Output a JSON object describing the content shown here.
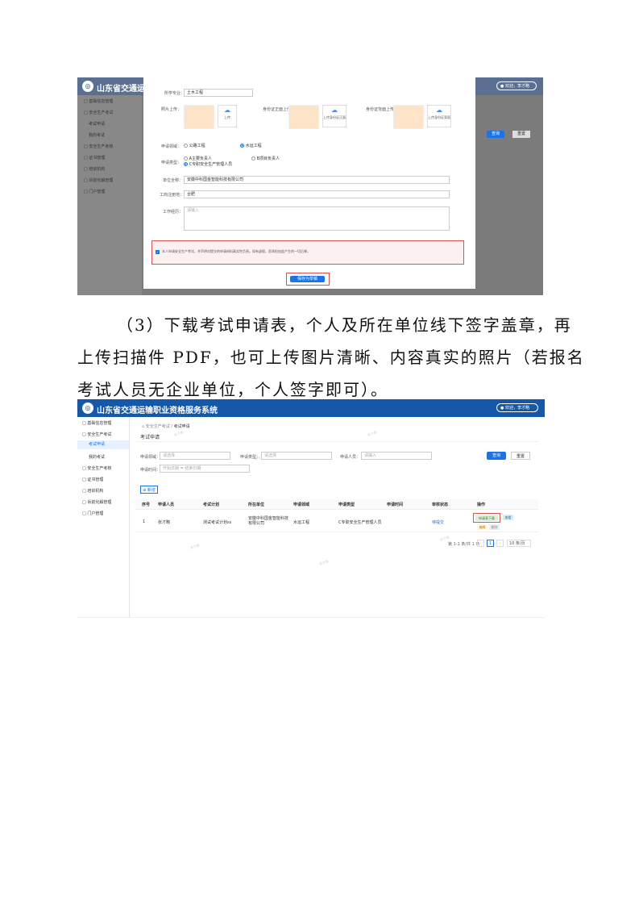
{
  "shot1": {
    "app_title": "山东省交通运输职业资格服务系统",
    "app_title_visible": "山东省交通运输职",
    "user_label": "欢迎，李才略",
    "sidebar": [
      "基础信息管理",
      "安全生产考试",
      "考试申请",
      "我的考试",
      "安全生产考核",
      "证书管理",
      "培训机构",
      "诉前化解管理",
      "门户管理"
    ],
    "form": {
      "major_label": "所学专业：",
      "major_value": "土木工程",
      "photo_label": "照片上传：",
      "id_front_label": "身份证正面上传：",
      "id_back_label": "身份证背面上传：",
      "upload_text": "上传",
      "upload_id_front": "上传身份证正面",
      "upload_id_back": "上传身份证背面",
      "field_label": "申请领域：",
      "field_options": [
        "公路工程",
        "水运工程"
      ],
      "type_label": "申请类型：",
      "type_options": [
        "A主要负责人",
        "B项目负责人",
        "C专职安全生产管理人员"
      ],
      "unit_label": "单位全称：",
      "unit_value": "安徽中科国金智能科技有限公司",
      "business_label": "工商注册地：",
      "business_value": "合肥",
      "experience_label": "工作经历：",
      "experience_placeholder": "请输入",
      "agreement_text": "本人申请安全生产考试，并声明对提交的申请材料真实性负责。如有虚假，愿承担由此产生的一切后果。",
      "submit_label": "保存为草稿",
      "query_label": "查询",
      "reset_label": "重置"
    }
  },
  "paragraph": {
    "line1": "（3）下载考试申请表，个人及所在单位线下签字盖章，再",
    "line2": "上传扫描件 PDF，也可上传图片清晰、内容真实的照片（若报名",
    "line3": "考试人员无企业单位，个人签字即可）。"
  },
  "shot2": {
    "app_title": "山东省交通运输职业资格服务系统",
    "user_label": "欢迎，李才略",
    "sidebar": [
      "基础信息管理",
      "安全生产考试",
      "考试申请",
      "我的考试",
      "安全生产考核",
      "证书管理",
      "培训机构",
      "诉前化解管理",
      "门户管理"
    ],
    "breadcrumb": [
      "安全生产考试",
      "考试申请"
    ],
    "page_title": "考试申请",
    "filters": {
      "field_label": "申请领域：",
      "field_placeholder": "请选择",
      "type_label": "申请类型：",
      "type_placeholder": "请选择",
      "person_label": "申请人员：",
      "person_placeholder": "请输入",
      "time_label": "申请时间：",
      "time_start": "开始日期",
      "time_sep": "~",
      "time_end": "结束日期",
      "query_label": "查询",
      "reset_label": "重置"
    },
    "add_label": "新增",
    "columns": [
      "序号",
      "申请人员",
      "考试计划",
      "所在单位",
      "申请领域",
      "申请类型",
      "申请时间",
      "审核状态",
      "操作"
    ],
    "rows": [
      {
        "index": "1",
        "person": "张才略",
        "plan": "测试考试计划ss",
        "unit": "安徽中科国金智能科技有限公司",
        "field": "水运工程",
        "type": "C专职安全生产管理人员",
        "time": "",
        "status": "待提交",
        "actions": [
          "申请表下载",
          "查看",
          "编辑",
          "删除"
        ]
      }
    ],
    "pagination": {
      "summary": "第 1-1 条/共 1 条",
      "current": "1",
      "page_size": "10 条/页"
    }
  }
}
